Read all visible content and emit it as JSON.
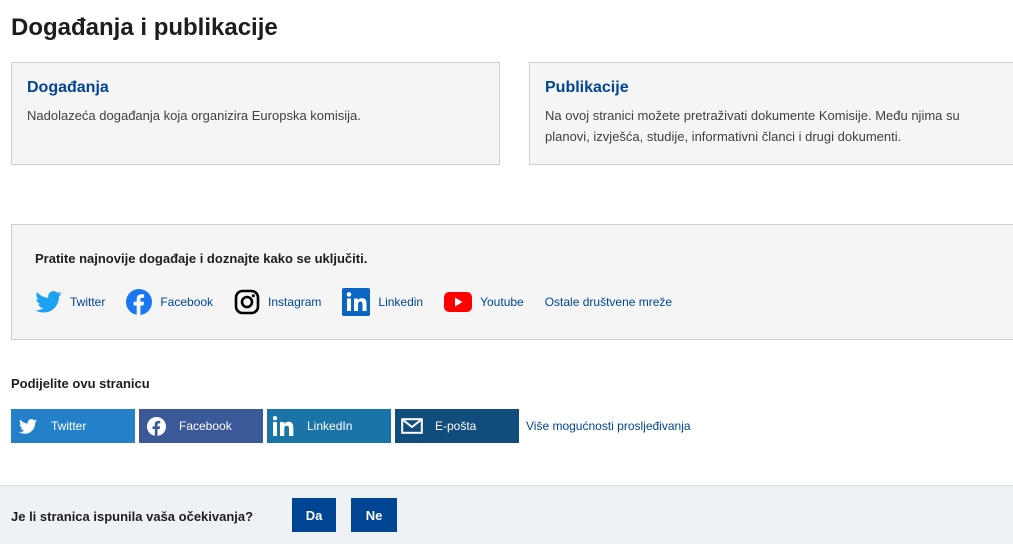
{
  "page_title": "Događanja i publikacije",
  "cards": [
    {
      "title": "Događanja",
      "text": "Nadolazeća događanja koja organizira Europska komisija."
    },
    {
      "title": "Publikacije",
      "text": "Na ovoj stranici možete pretraživati dokumente Komisije. Među njima su planovi, izvješća, studije, informativni članci i drugi dokumenti."
    }
  ],
  "follow": {
    "heading": "Pratite najnovije događaje i doznajte kako se uključiti.",
    "links": [
      {
        "label": "Twitter",
        "icon": "twitter-icon"
      },
      {
        "label": "Facebook",
        "icon": "facebook-icon"
      },
      {
        "label": "Instagram",
        "icon": "instagram-icon"
      },
      {
        "label": "Linkedin",
        "icon": "linkedin-icon"
      },
      {
        "label": "Youtube",
        "icon": "youtube-icon"
      }
    ],
    "other": "Ostale društvene mreže"
  },
  "share": {
    "label": "Podijelite ovu stranicu",
    "buttons": [
      {
        "label": "Twitter",
        "icon": "twitter-icon",
        "color": "#1da1f2"
      },
      {
        "label": "Facebook",
        "icon": "facebook-icon",
        "color": "#3b5998"
      },
      {
        "label": "LinkedIn",
        "icon": "linkedin-icon",
        "color": "#0077b5"
      },
      {
        "label": "E-pošta",
        "icon": "envelope-icon",
        "color": "#104c7c"
      }
    ],
    "more": "Više mogućnosti prosljeđivanja"
  },
  "feedback": {
    "question": "Je li stranica ispunila vaša očekivanja?",
    "yes": "Da",
    "no": "Ne"
  },
  "colors": {
    "link": "#004494",
    "card_bg": "#f5f5f5",
    "feedback_bg": "#eef2f7",
    "button": "#004494"
  }
}
